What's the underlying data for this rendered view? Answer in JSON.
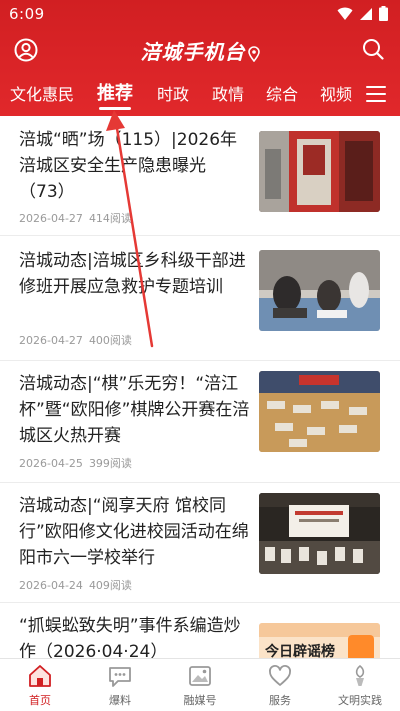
{
  "status_bar": {
    "time": "6:09"
  },
  "header": {
    "brand": "涪城手机台"
  },
  "tabs": [
    {
      "label": "文化惠民",
      "active": false
    },
    {
      "label": "推荐",
      "active": true
    },
    {
      "label": "时政",
      "active": false
    },
    {
      "label": "政情",
      "active": false
    },
    {
      "label": "综合",
      "active": false
    },
    {
      "label": "视频",
      "active": false
    }
  ],
  "articles": [
    {
      "title": "涪城“晒”场（115）|2026年涪城区安全生产隐患曝光（73）",
      "date": "2026-04-27",
      "reads": "414阅读"
    },
    {
      "title": "涪城动态|涪城区乡科级干部进修班开展应急救护专题培训",
      "date": "2026-04-27",
      "reads": "400阅读"
    },
    {
      "title": "涪城动态|“棋”乐无穷！“涪江杯”暨“欧阳修”棋牌公开赛在涪城区火热开赛",
      "date": "2026-04-25",
      "reads": "399阅读"
    },
    {
      "title": "涪城动态|“阅享天府 馆校同行”欧阳修文化进校园活动在绵阳市六一学校举行",
      "date": "2026-04-24",
      "reads": "409阅读"
    },
    {
      "title": "“抓蜈蚣致失明”事件系编造炒作（2026·04·24）",
      "thumb_text": "今日辟谣榜"
    }
  ],
  "bottom_nav": [
    {
      "label": "首页",
      "active": true
    },
    {
      "label": "爆料",
      "active": false
    },
    {
      "label": "融媒号",
      "active": false
    },
    {
      "label": "服务",
      "active": false
    },
    {
      "label": "文明实践",
      "active": false
    }
  ],
  "colors": {
    "brand_red": "#d11f22",
    "annotation_arrow": "#e53935"
  }
}
